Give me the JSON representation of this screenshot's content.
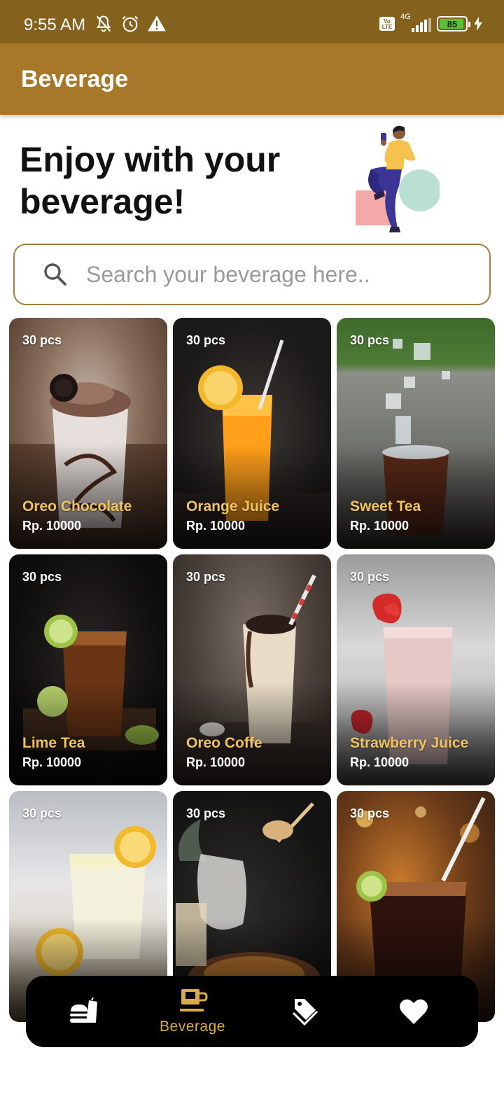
{
  "status_bar": {
    "time": "9:55 AM",
    "network": "4G",
    "battery": "85",
    "icons": [
      "mute-icon",
      "alarm-icon",
      "warning-icon",
      "volte-icon",
      "signal-icon",
      "battery-icon",
      "charging-icon"
    ]
  },
  "app_bar": {
    "title": "Beverage"
  },
  "hero": {
    "title": "Enjoy with your beverage!"
  },
  "search": {
    "placeholder": "Search your beverage here..",
    "value": ""
  },
  "colors": {
    "status_bar": "#84621e",
    "app_bar": "#a7782a",
    "accent": "#d7ab4c",
    "product_name": "#f1c35e",
    "search_border": "#a07d3c"
  },
  "products": [
    {
      "stock": "30 pcs",
      "name": "Oreo Chocolate",
      "price": "Rp. 10000"
    },
    {
      "stock": "30 pcs",
      "name": "Orange Juice",
      "price": "Rp. 10000"
    },
    {
      "stock": "30 pcs",
      "name": "Sweet Tea",
      "price": "Rp. 10000"
    },
    {
      "stock": "30 pcs",
      "name": "Lime Tea",
      "price": "Rp. 10000"
    },
    {
      "stock": "30 pcs",
      "name": "Oreo Coffe",
      "price": "Rp. 10000"
    },
    {
      "stock": "30 pcs",
      "name": "Strawberry Juice",
      "price": "Rp. 10000"
    },
    {
      "stock": "30 pcs",
      "name": "",
      "price": ""
    },
    {
      "stock": "30 pcs",
      "name": "",
      "price": ""
    },
    {
      "stock": "30 pcs",
      "name": "",
      "price": ""
    }
  ],
  "bottom_nav": {
    "items": [
      {
        "icon": "food-icon",
        "label": "",
        "active": false
      },
      {
        "icon": "coffee-cup-icon",
        "label": "Beverage",
        "active": true
      },
      {
        "icon": "tag-icon",
        "label": "",
        "active": false
      },
      {
        "icon": "heart-icon",
        "label": "",
        "active": false
      }
    ]
  }
}
